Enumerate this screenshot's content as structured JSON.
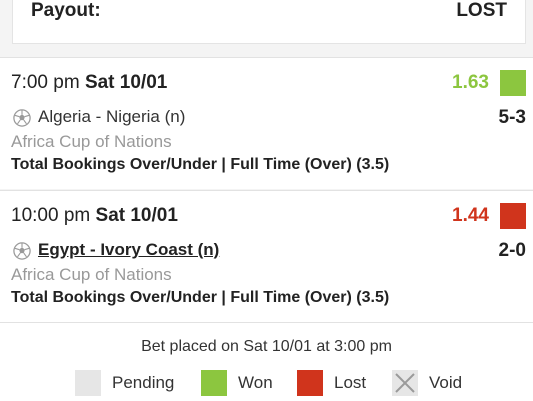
{
  "payout": {
    "label": "Payout:",
    "value": "LOST"
  },
  "selections": [
    {
      "time": "7:00 pm",
      "day": "Sat 10/01",
      "odds": "1.63",
      "result": "won",
      "result_color": "#8cc63f",
      "sport_icon": "soccer-ball-icon",
      "match": "Algeria - Nigeria (n)",
      "score": "5-3",
      "competition": "Africa Cup of Nations",
      "market": "Total Bookings Over/Under | Full Time (Over) (3.5)"
    },
    {
      "time": "10:00 pm",
      "day": "Sat 10/01",
      "odds": "1.44",
      "result": "lost",
      "result_color": "#d0341c",
      "sport_icon": "soccer-ball-icon",
      "match": "Egypt - Ivory Coast (n)",
      "score": "2-0",
      "competition": "Africa Cup of Nations",
      "market": "Total Bookings Over/Under | Full Time (Over) (3.5)"
    }
  ],
  "footer": {
    "placed": "Bet placed on Sat 10/01 at 3:00 pm",
    "legend": [
      {
        "label": "Pending",
        "color": "#e6e6e6"
      },
      {
        "label": "Won",
        "color": "#8cc63f"
      },
      {
        "label": "Lost",
        "color": "#d0341c"
      },
      {
        "label": "Void",
        "color": "#e6e6e6",
        "icon": "x-icon"
      }
    ]
  }
}
